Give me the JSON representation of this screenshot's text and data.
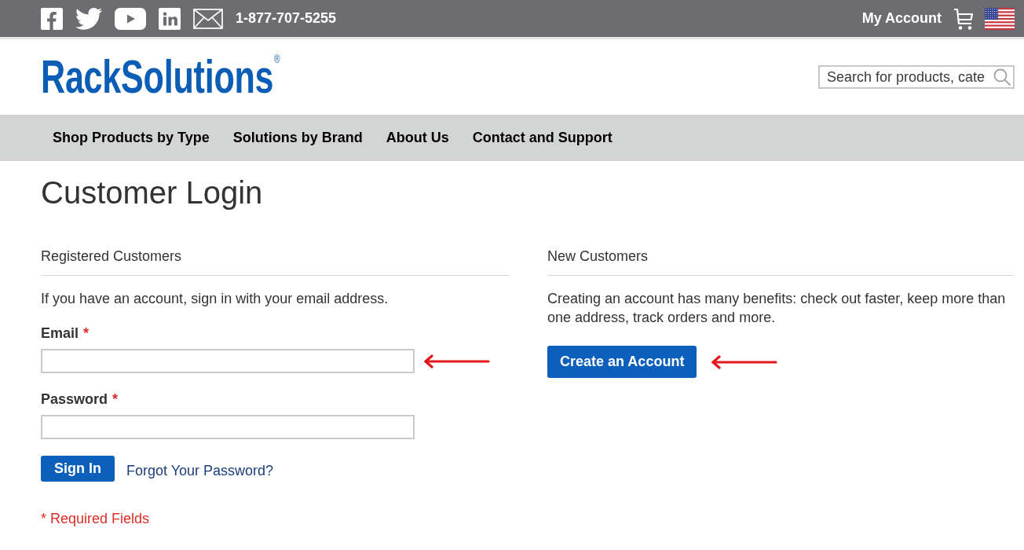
{
  "top_bar": {
    "phone": "1-877-707-5255",
    "account_link": "My Account"
  },
  "header": {
    "logo": "RackSolutions$^{®}$",
    "search": {
      "placeholder": "Search for products, cate"
    }
  },
  "nav": {
    "items": [
      "Shop Products by Type",
      "Solutions by Brand",
      "About Us",
      "Contact and Support"
    ]
  },
  "page_title": "Customer Login",
  "registered_customers": {
    "heading": "Registered Customers",
    "intro": "If you have an account, sign in with your email address.",
    "fields": [
      {
        "label": "Email",
        "required_mark": "*",
        "marked": true
      },
      {
        "label": "Password",
        "required_mark": "*",
        "marked": false
      }
    ],
    "sign_in_button": "Sign In",
    "forgot_link": "Forgot Your Password?",
    "required_note": "* Required Fields"
  },
  "new_customers": {
    "heading": "New Customers",
    "intro": "Creating an account has many benefits: check out faster, keep more than one address, track orders and more.",
    "create_button": {
      "label": "Create an Account",
      "marked": true
    }
  }
}
